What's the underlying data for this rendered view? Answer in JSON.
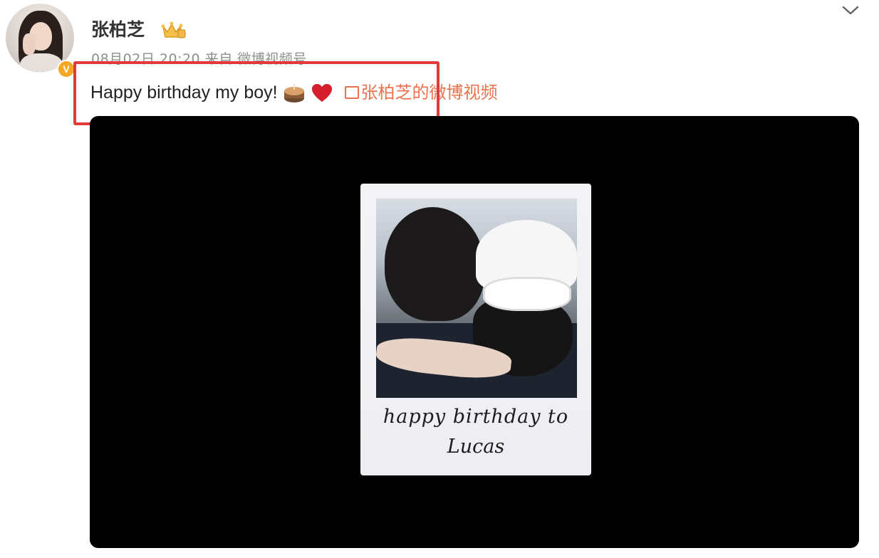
{
  "post": {
    "username": "张柏芝",
    "meta": "08月02日 20:20 来自 微博视频号",
    "text": "Happy birthday my boy!",
    "emojis": [
      "cake-emoji",
      "heart-emoji"
    ],
    "video_link": "张柏芝的微博视频",
    "verified_badge": "V"
  },
  "video": {
    "caption_line1": "happy birthday to",
    "caption_line2": "Lucas"
  },
  "colors": {
    "link": "#eb7350",
    "highlight": "#e03a3a",
    "meta": "#8f8f8f"
  }
}
